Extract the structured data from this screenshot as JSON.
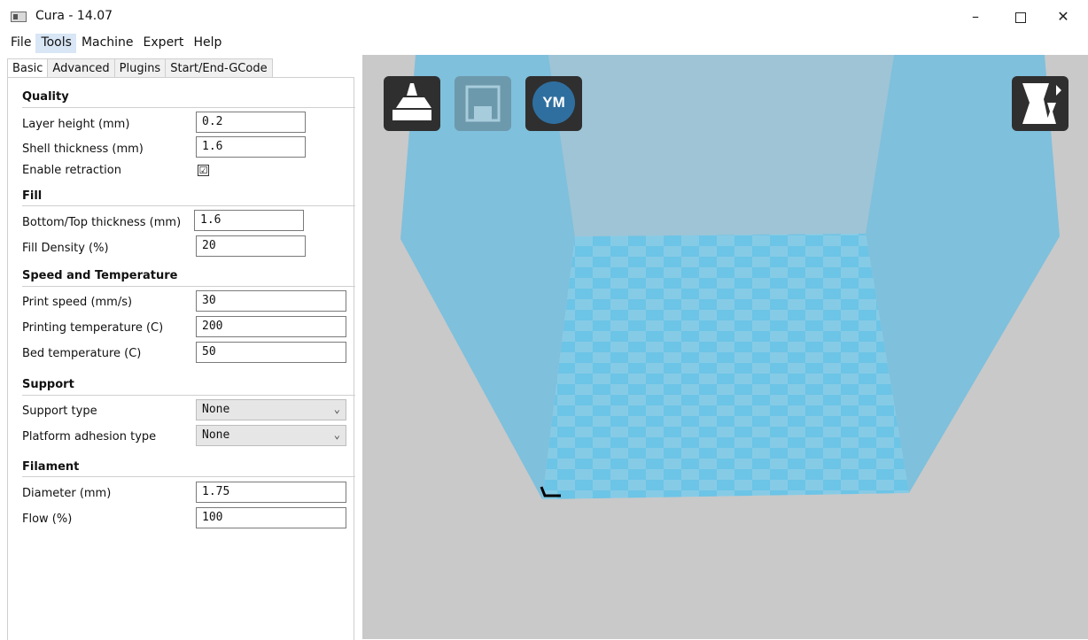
{
  "window": {
    "title": "Cura - 14.07",
    "minimize": "–",
    "close": "✕"
  },
  "menu": [
    "File",
    "Tools",
    "Machine",
    "Expert",
    "Help"
  ],
  "tabs": [
    "Basic",
    "Advanced",
    "Plugins",
    "Start/End-GCode"
  ],
  "sections": {
    "quality": {
      "title": "Quality",
      "layer_height": {
        "label": "Layer height (mm)",
        "value": "0.2"
      },
      "shell_thickness": {
        "label": "Shell thickness (mm)",
        "value": "1.6"
      },
      "enable_retraction": {
        "label": "Enable retraction",
        "checked": "☑"
      }
    },
    "fill": {
      "title": "Fill",
      "bottom_top": {
        "label": "Bottom/Top thickness (mm)",
        "value": "1.6"
      },
      "fill_density": {
        "label": "Fill Density (%)",
        "value": "20"
      }
    },
    "speed": {
      "title": "Speed and Temperature",
      "print_speed": {
        "label": "Print speed (mm/s)",
        "value": "30"
      },
      "printing_temp": {
        "label": "Printing temperature (C)",
        "value": "200"
      },
      "bed_temp": {
        "label": "Bed temperature (C)",
        "value": "50"
      }
    },
    "support": {
      "title": "Support",
      "support_type": {
        "label": "Support type",
        "value": "None"
      },
      "platform_adhesion": {
        "label": "Platform adhesion type",
        "value": "None"
      }
    },
    "filament": {
      "title": "Filament",
      "diameter": {
        "label": "Diameter (mm)",
        "value": "1.75"
      },
      "flow": {
        "label": "Flow (%)",
        "value": "100"
      }
    }
  },
  "viewport": {
    "ym_label": "YM",
    "colors": {
      "volume": "#7fc0dc",
      "back_wall": "#9ec4d6",
      "bed_a": "#6cc4e6",
      "bed_b": "#86cbe6",
      "background": "#c9c9c9"
    }
  }
}
